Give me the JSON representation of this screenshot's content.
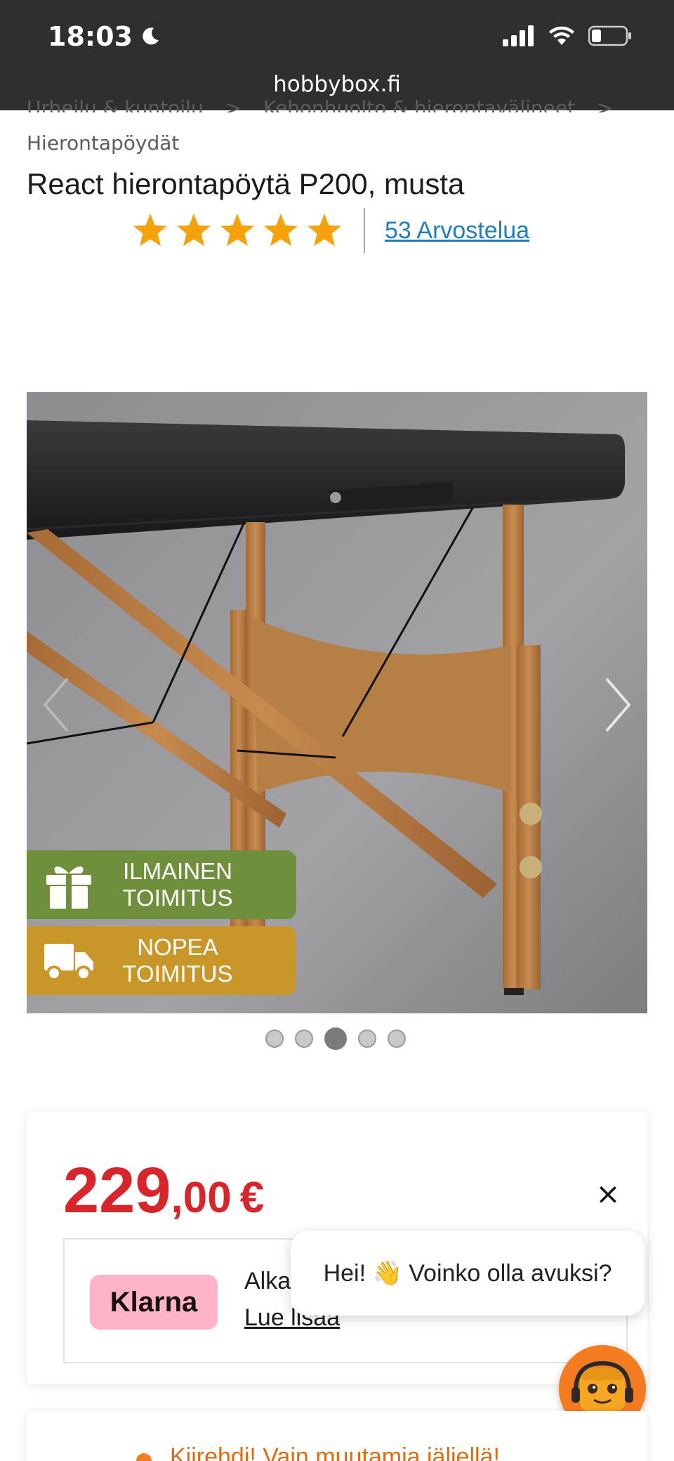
{
  "status_bar": {
    "time": "18:03",
    "url": "hobbybox.fi"
  },
  "breadcrumb": {
    "items": [
      "Urheilu & kuntoilu",
      "Kehonhuolto & hierontavälineet",
      "Hierontapöydät"
    ],
    "separator": ">"
  },
  "product": {
    "title": "React hierontapöytä P200, musta",
    "rating": 5,
    "rating_max": 5,
    "reviews_label": "53 Arvostelua"
  },
  "gallery": {
    "badges": [
      {
        "line1": "ILMAINEN",
        "line2": "TOIMITUS",
        "color": "#6f8f3c",
        "icon": "gift-icon"
      },
      {
        "line1": "NOPEA",
        "line2": "TOIMITUS",
        "color": "#c9962a",
        "icon": "truck-icon"
      }
    ],
    "total_images": 5,
    "active_index": 3
  },
  "price": {
    "integer": "229",
    "decimals": ",00",
    "currency": "€",
    "color": "#d6262b"
  },
  "klarna": {
    "logo": "Klarna",
    "text": "Alka",
    "link": "Lue lisää"
  },
  "chat": {
    "greeting": "Hei! 👋 Voinko olla avuksi?",
    "close": "×"
  },
  "stock": {
    "message": "Kiirehdi! Vain muutamia jäljellä!",
    "color": "#f47b20"
  }
}
